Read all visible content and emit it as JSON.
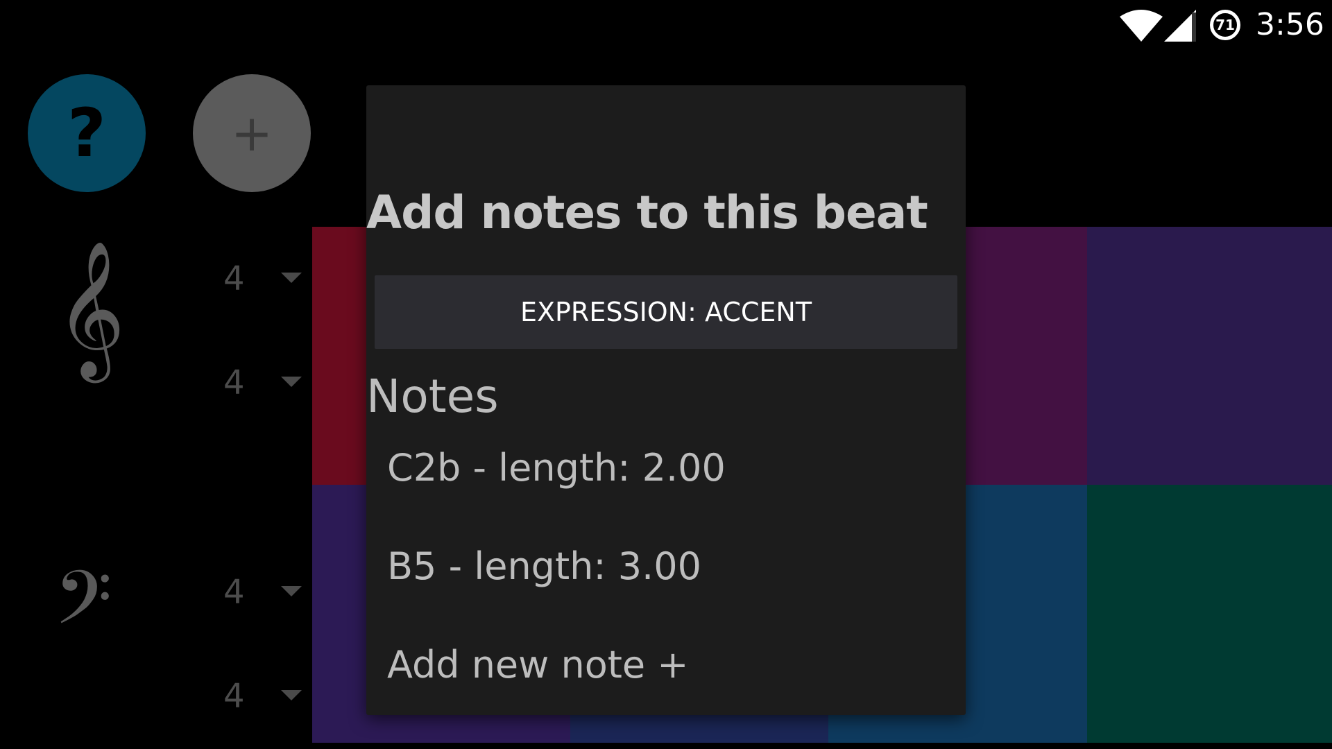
{
  "status_bar": {
    "battery_level": "71",
    "time": "3:56",
    "wifi_icon": "wifi-icon",
    "signal_icon": "cell-signal-icon"
  },
  "toolbar": {
    "help_glyph": "?",
    "add_glyph": "+"
  },
  "staves": {
    "treble": {
      "clef": "𝄞",
      "time_top": "4",
      "time_bottom": "4"
    },
    "bass": {
      "clef": "𝄢",
      "time_top": "4",
      "time_bottom": "4"
    }
  },
  "colors": {
    "help_fab": "#044760",
    "add_fab": "#5b5b5b",
    "beat_cells": [
      "#6a0b1e",
      "#431142",
      "#2a1a4d",
      "#2c1a55",
      "#0e3a5e",
      "#003a32"
    ]
  },
  "dialog": {
    "title": "Add notes to this beat",
    "expression_button": "EXPRESSION: ACCENT",
    "notes_heading": "Notes",
    "notes": [
      "C2b - length: 2.00",
      "B5 - length: 3.00"
    ],
    "add_note": "Add new note +"
  }
}
